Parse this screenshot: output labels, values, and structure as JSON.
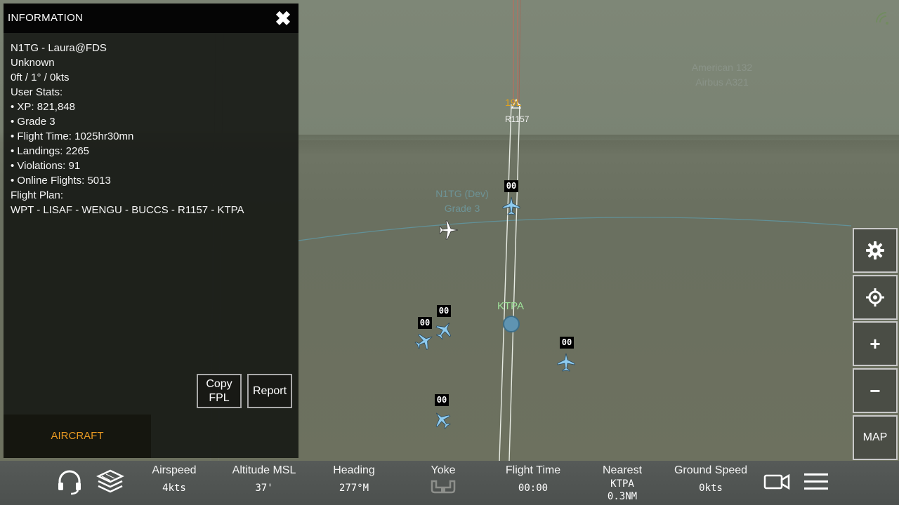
{
  "info_panel": {
    "title": "INFORMATION",
    "close_symbol": "✖",
    "lines": [
      "N1TG - Laura@FDS",
      "Unknown",
      "0ft / 1° / 0kts",
      "User Stats:",
      "• XP: 821,848",
      "•  Grade 3",
      "•  Flight Time: 1025hr30mn",
      "•  Landings: 2265",
      "• Violations: 91",
      "•  Online Flights: 5013",
      "Flight Plan:",
      "WPT - LISAF - WENGU - BUCCS - R1157 - KTPA"
    ],
    "copy_fpl_line1": "Copy",
    "copy_fpl_line2": "FPL",
    "report_label": "Report",
    "aircraft_tab": "AIRCRAFT"
  },
  "map": {
    "other_aircraft_label_line1": "American 132",
    "other_aircraft_label_line2": "Airbus A321",
    "selected_label_line1": "N1TG (Dev)",
    "selected_label_line2": "Grade 3",
    "runway_number": "19L",
    "waypoint": "R1157",
    "airport": "KTPA",
    "traffic_tag": "00",
    "colors": {
      "traffic_aircraft": "#8ecbef",
      "selected_aircraft": "#ffffff",
      "airport_label": "#9fe39a",
      "runway_number": "#e0a21e",
      "aircraft_tab": "#e69822"
    }
  },
  "side_controls": {
    "settings_icon": "gear-icon",
    "locate_icon": "crosshair-icon",
    "zoom_in_symbol": "+",
    "zoom_out_symbol": "−",
    "map_label": "MAP"
  },
  "bottom_bar": {
    "icons": [
      "headset-icon",
      "layers-icon",
      "yoke-icon",
      "camera-icon",
      "menu-icon"
    ],
    "airspeed": {
      "label": "Airspeed",
      "value": "4kts"
    },
    "altitude": {
      "label": "Altitude MSL",
      "value": "37'"
    },
    "heading": {
      "label": "Heading",
      "value": "277°M"
    },
    "yoke": {
      "label": "Yoke"
    },
    "flight_time": {
      "label": "Flight Time",
      "value": "00:00"
    },
    "nearest": {
      "label": "Nearest",
      "airport": "KTPA",
      "distance": "0.3NM"
    },
    "ground_speed": {
      "label": "Ground Speed",
      "value": "0kts"
    }
  }
}
